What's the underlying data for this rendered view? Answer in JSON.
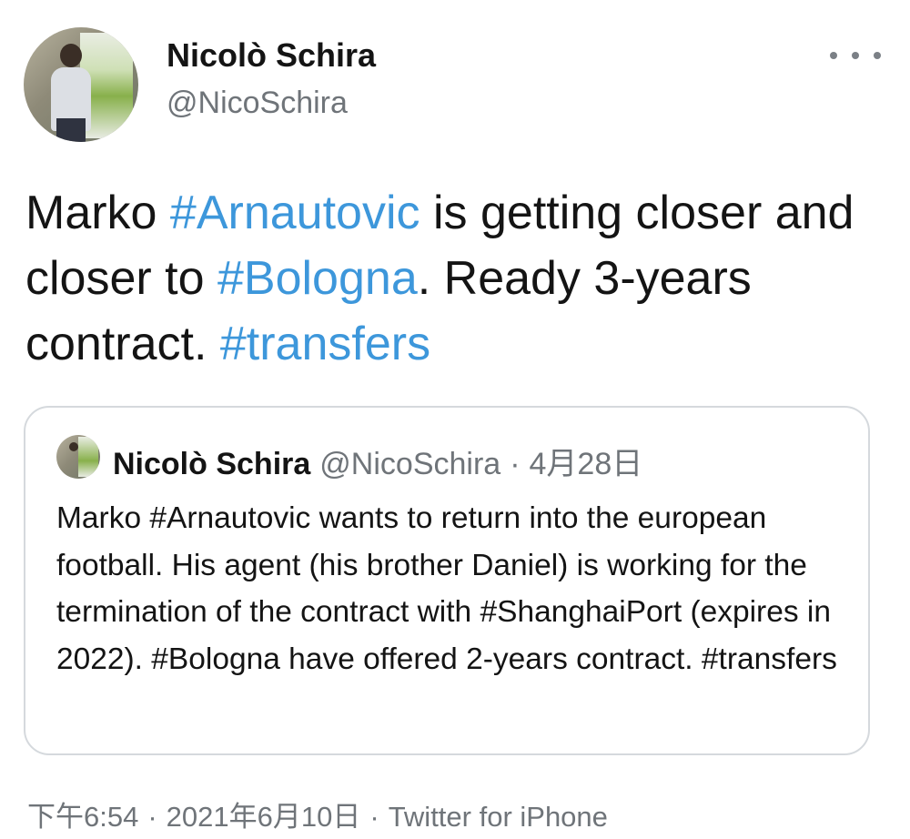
{
  "tweet": {
    "author": {
      "name": "Nicolò Schira",
      "handle": "@NicoSchira"
    },
    "text": [
      {
        "t": "Marko ",
        "tag": false
      },
      {
        "t": "#Arnautovic",
        "tag": true
      },
      {
        "t": " is getting closer and closer to ",
        "tag": false
      },
      {
        "t": "#Bologna",
        "tag": true
      },
      {
        "t": ". Ready 3-years contract. ",
        "tag": false
      },
      {
        "t": "#transfers",
        "tag": true
      }
    ],
    "time": "下午6:54",
    "date": "2021年6月10日",
    "source": "Twitter for iPhone"
  },
  "quoted": {
    "name": "Nicolò Schira",
    "handle": "@NicoSchira",
    "separator": "·",
    "date": "4月28日",
    "text": "Marko #Arnautovic wants to return into the european football. His agent (his brother Daniel) is working for the termination of the contract with #ShanghaiPort (expires in 2022). #Bologna have offered 2-years contract. #transfers"
  },
  "icons": {
    "more": "more-horizontal-icon",
    "avatar": "profile-photo"
  },
  "colors": {
    "hashtag": "#3d97db",
    "secondary_text": "#6f7479",
    "border": "#d5d9dd"
  }
}
